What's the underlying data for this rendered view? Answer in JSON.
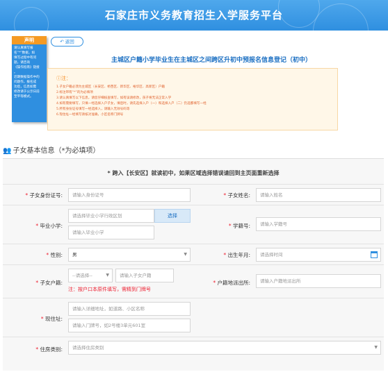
{
  "header": {
    "title": "石家庄市义务教育招生入学服务平台"
  },
  "notice": {
    "heading": "声明",
    "lines": [
      "请认真填写报",
      "名“*”数据，如",
      "填写过程中有问",
      "题，请咨询",
      "《操作指南》链接",
      "。",
      "近期数据操作中的",
      "问题作，报名成",
      "功后，信息如需",
      "修改请于公示日前",
      "至平等模式。"
    ],
    "highlight": "《操作指南》"
  },
  "back_button": {
    "label": "返回"
  },
  "form_title": "主城区户籍小学毕业生在主城区之间跨区升初中预报名信息登记（初中）",
  "tips": {
    "heading": "注：",
    "items": [
      "1.子女户籍必须为主城区（长安区、桥西区、新华区、裕华区、高新区）户籍",
      "2.标注带有“*”的为必填项",
      "3.请认真填写以下信息，请您仔细核查填写，如有误请修改，孩子将无法正常入学",
      "4.如有需要填写，只填一经选择入户子女，填后时，请先选择入户（一）和选择入户（二）仍选都填写一经",
      "5.所有身份证号填写一经选择入，请输入无效号码等",
      "6.现住址一经填写请核对准确，小区名称门牌号"
    ]
  },
  "section": {
    "title": "子女基本信息（*为必填项）"
  },
  "district_notice": "* 跨入【长安区】就读初中，如果区域选择错误请回到主页面重新选择",
  "fields": {
    "id_number": {
      "label": "子女身份证号:",
      "placeholder": "请输入身份证号"
    },
    "child_name": {
      "label": "子女姓名:",
      "placeholder": "请输入姓名"
    },
    "primary_school": {
      "label": "毕业小学:",
      "district_placeholder": "请选择毕业小学行政区划",
      "select_button": "选择",
      "name_placeholder": "请输入毕业小学"
    },
    "student_no": {
      "label": "学籍号:",
      "placeholder": "请输入学籍号"
    },
    "gender": {
      "label": "性别:",
      "value": "男"
    },
    "birth": {
      "label": "出生年月:",
      "placeholder": "请选择时间"
    },
    "hukou": {
      "label": "子女户籍:",
      "select_placeholder": "--请选择--",
      "input_placeholder": "请输入子女户籍",
      "warning": "注：按户口本原件填写，需精到门牌号"
    },
    "police_station": {
      "label": "户籍地派出所:",
      "placeholder": "请输入户籍地派出所"
    },
    "address": {
      "label": "现住址:",
      "placeholder_1": "请输入详细地址，如道路、小区名称",
      "placeholder_2": "请输入门牌号，如2号楼3单元601室"
    },
    "housing": {
      "label": "住房类别:",
      "placeholder": "请选择住房类别"
    }
  },
  "colors": {
    "brand_blue": "#2f8fe0",
    "notice_orange": "#f59a23",
    "warning_red": "#e23322"
  }
}
